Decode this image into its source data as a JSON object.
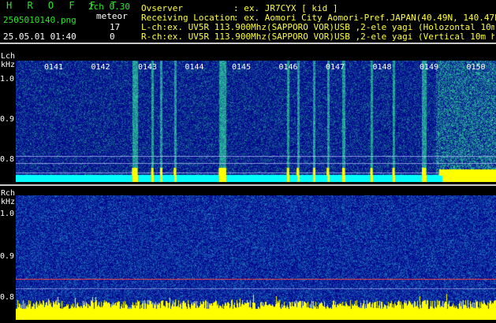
{
  "header": {
    "logo": "H R O F F T",
    "version": "2ch 0.30",
    "filename": "2505010140.png",
    "datetime": "25.05.01 01:40",
    "meteor_label": "meteor",
    "count_lch": "17",
    "count_rch": "0",
    "observer_label": "Ovserver",
    "observer_value": ": ex. JR7CYX [ kid ]",
    "location_label": "Receiving Location",
    "location_value": ": ex. Aomori City Aomori-Pref.JAPAN(40.49N, 140.47E)",
    "lch_info": "L-ch:ex. UV5R 113.900Mhz(SAPPORO VOR)USB ,2-ele yagi (Holozontal 10m height)",
    "rch_info": "R-ch:ex. UV5R 113.900Mhz(SAPPORO VOR)USB ,2-ele yagi (Vertical 10m height)"
  },
  "lch_panel": {
    "channel_label": "Lch",
    "unit_label": "kHz",
    "y_ticks": [
      "1.0",
      "0.9",
      "0.8"
    ],
    "time_labels": [
      "0141",
      "0142",
      "0143",
      "0144",
      "0145",
      "0146",
      "0147",
      "0148",
      "0149",
      "0150"
    ],
    "meteor_bursts": [
      {
        "minute": 1.87,
        "width": 0.12
      },
      {
        "minute": 2.28,
        "width": 0.05
      },
      {
        "minute": 2.47,
        "width": 0.04
      },
      {
        "minute": 2.76,
        "width": 0.05
      },
      {
        "minute": 3.72,
        "width": 0.16
      },
      {
        "minute": 5.17,
        "width": 0.04
      },
      {
        "minute": 5.38,
        "width": 0.04
      },
      {
        "minute": 5.73,
        "width": 0.05
      },
      {
        "minute": 6.02,
        "width": 0.04
      },
      {
        "minute": 6.35,
        "width": 0.06
      },
      {
        "minute": 6.95,
        "width": 0.03
      },
      {
        "minute": 7.42,
        "width": 0.04
      },
      {
        "minute": 8.05,
        "width": 0.09
      }
    ],
    "colors": {
      "noise_low": "#00008c",
      "noise_high": "#33dca0",
      "signal": "#ffff00",
      "baseline": "#00ffff"
    }
  },
  "rch_panel": {
    "channel_label": "Rch",
    "unit_label": "kHz",
    "y_ticks": [
      "1.0",
      "0.9",
      "0.8"
    ],
    "colors": {
      "noise_low": "#00008c",
      "noise_high": "#2aa6d0",
      "signal": "#ffff00",
      "carrier": "#ff4040"
    }
  }
}
